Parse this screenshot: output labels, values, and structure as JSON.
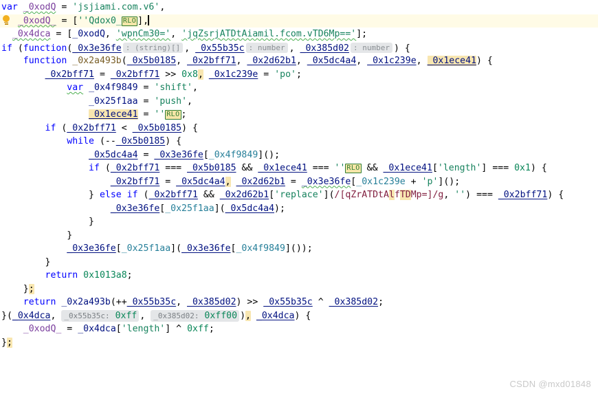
{
  "app": {
    "kind": "code-editor",
    "language": "javascript",
    "theme": "light",
    "colors": {
      "background": "#ffffff",
      "foreground": "#000000",
      "keyword": "#0000ff",
      "string": "#16825d",
      "number": "#098658",
      "identifier": "#001080",
      "variable": "#7a3e9d",
      "function": "#795e26",
      "property": "#0070c1",
      "member": "#267f99",
      "regex": "#811f3f",
      "search_highlight": "#f8e6b0",
      "current_line": "#fffbe6",
      "inlay_hint_bg": "#e4e6e8",
      "inlay_hint_fg": "#8a8f94",
      "rlo_border": "#2e7d32",
      "squiggle": "#4caf50",
      "watermark": "#c9c9c9"
    }
  },
  "watermark": {
    "text": "CSDN @mxd01848"
  },
  "gutter": {
    "quickfix_icon": "lightbulb-icon",
    "quickfix_line": 2
  },
  "inlay_hints": {
    "param_types": [
      {
        "name": "_0x3e36fe",
        "type": ": (string)[]"
      },
      {
        "name": "_0x55b35c",
        "type": ": number"
      },
      {
        "name": "_0x385d02",
        "type": ": number"
      }
    ],
    "param_names": [
      {
        "name": "_0x55b35c:",
        "value": "0xff"
      },
      {
        "name": "_0x385d02:",
        "value": "0xff00"
      }
    ]
  },
  "special_chars": {
    "marker_label": "RLO",
    "description": "U+202E RIGHT-TO-LEFT OVERRIDE highlighted as invisible character",
    "occurrences": 3
  },
  "code": {
    "lines": [
      "var _0xodQ = 'jsjiami.com.v6',",
      "  _0xodQ_ = [''Qdox0_RLO],",
      "  _0x4dca = [_0xodQ, 'wpnCm30=', 'jqZsrjATDtAiamil.fcom.vTD6Mp=='];",
      "if (function(_0x3e36fe : (string)[] , _0x55b35c : number , _0x385d02 : number ) {",
      "    function _0x2a493b(_0x5b0185, _0x2bff71, _0x2d62b1, _0x5dc4a4, _0x1c239e, _0x1ece41) {",
      "        _0x2bff71 = _0x2bff71 >> 0x8, _0x1c239e = 'po';",
      "        var _0x4f9849 = 'shift',",
      "            _0x25f1aa = 'push',",
      "            _0x1ece41 = ''RLO;",
      "        if (_0x2bff71 < _0x5b0185) {",
      "            while (--_0x5b0185) {",
      "                _0x5dc4a4 = _0x3e36fe[_0x4f9849]();",
      "                if (_0x2bff71 === _0x5b0185 && _0x1ece41 === ''RLO && _0x1ece41['length'] === 0x1) {",
      "                    _0x2bff71 = _0x5dc4a4, _0x2d62b1 = _0x3e36fe[_0x1c239e + 'p']();",
      "                } else if (_0x2bff71 && _0x2d62b1['replace'](/[qZrATDtAlfTDMp=]/g, '') === _0x2bff71) {",
      "                    _0x3e36fe[_0x25f1aa](_0x5dc4a4);",
      "                }",
      "            }",
      "            _0x3e36fe[_0x25f1aa](_0x3e36fe[_0x4f9849]());",
      "        }",
      "        return 0x1013a8;",
      "    };",
      "    return _0x2a493b(++_0x55b35c, _0x385d02) >> _0x55b35c ^ _0x385d02;",
      "}(_0x4dca, _0x55b35c: 0xff, _0x385d02: 0xff00), _0x4dca) {",
      "    _0xodQ_ = _0x4dca['length'] ^ 0xff;",
      "};"
    ],
    "tokens": {
      "keywords": [
        "var",
        "if",
        "function",
        "while",
        "else",
        "return"
      ],
      "strings": [
        "'jsjiami.com.v6'",
        "''",
        "'wpnCm30='",
        "'jqZsrjATDtAiamil.fcom.vTD6Mp=='",
        "'po'",
        "'shift'",
        "'push'",
        "'p'",
        "'length'",
        "'replace'"
      ],
      "numbers": [
        "0x8",
        "0x1",
        "0x1013a8",
        "0xff",
        "0xff00"
      ],
      "regex": "/[qZrATDtAlfTDMp=]/g",
      "identifiers": [
        "_0xodQ",
        "_0xodQ_",
        "_0x4dca",
        "_0x3e36fe",
        "_0x55b35c",
        "_0x385d02",
        "_0x2a493b",
        "_0x5b0185",
        "_0x2bff71",
        "_0x2d62b1",
        "_0x5dc4a4",
        "_0x1c239e",
        "_0x1ece41",
        "_0x4f9849",
        "_0x25f1aa"
      ]
    }
  }
}
